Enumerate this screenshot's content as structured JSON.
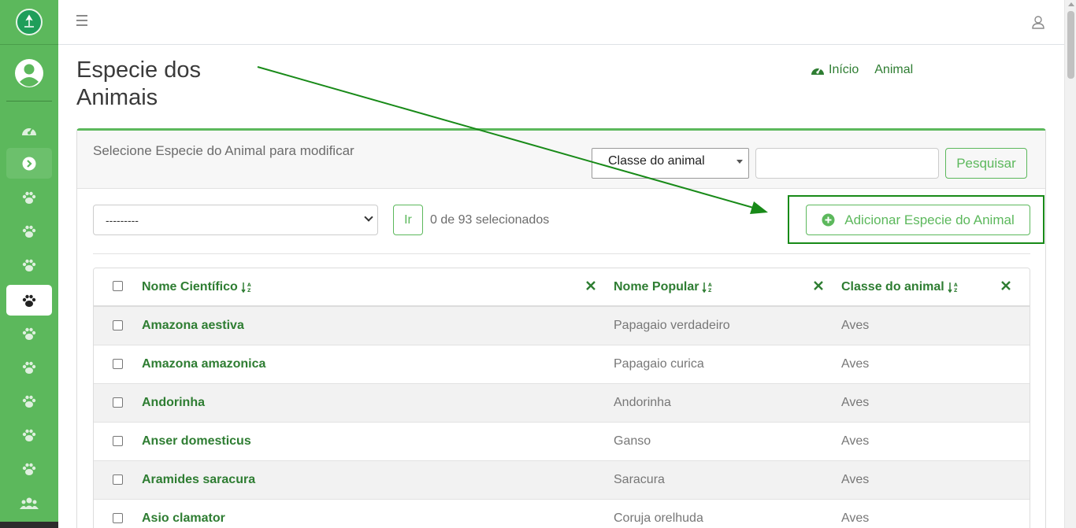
{
  "header": {
    "page_title": "Especie dos Animais",
    "breadcrumb": [
      {
        "label": "Início",
        "icon": "gauge-icon"
      },
      {
        "label": "Animal"
      }
    ]
  },
  "card": {
    "subtitle": "Selecione Especie do Animal para modificar",
    "filter_select_value": "Classe do animal",
    "search_value": "",
    "search_button": "Pesquisar",
    "action_select_value": "---------",
    "go_button": "Ir",
    "selection_count": "0 de 93 selecionados",
    "add_button": "Adicionar Especie do Animal"
  },
  "table": {
    "columns": [
      "Nome Científico",
      "Nome Popular",
      "Classe do animal"
    ],
    "rows": [
      {
        "sci": "Amazona aestiva",
        "pop": "Papagaio verdadeiro",
        "cls": "Aves"
      },
      {
        "sci": "Amazona amazonica",
        "pop": "Papagaio curica",
        "cls": "Aves"
      },
      {
        "sci": "Andorinha",
        "pop": "Andorinha",
        "cls": "Aves"
      },
      {
        "sci": "Anser domesticus",
        "pop": "Ganso",
        "cls": "Aves"
      },
      {
        "sci": "Aramides saracura",
        "pop": "Saracura",
        "cls": "Aves"
      },
      {
        "sci": "Asio clamator",
        "pop": "Coruja orelhuda",
        "cls": "Aves"
      }
    ]
  },
  "sidebar": {
    "items": [
      "gauge-icon",
      "circle-arrow-right-icon",
      "paw-icon",
      "paw-icon",
      "paw-icon",
      "paw-icon",
      "paw-icon",
      "paw-icon",
      "paw-icon",
      "paw-icon",
      "paw-icon",
      "users-icon"
    ],
    "active_index": 5,
    "highlight_index": 1
  },
  "colors": {
    "sidebar": "#5cb85c",
    "accent_green": "#2e7d32",
    "annotation_arrow": "#188a18"
  }
}
